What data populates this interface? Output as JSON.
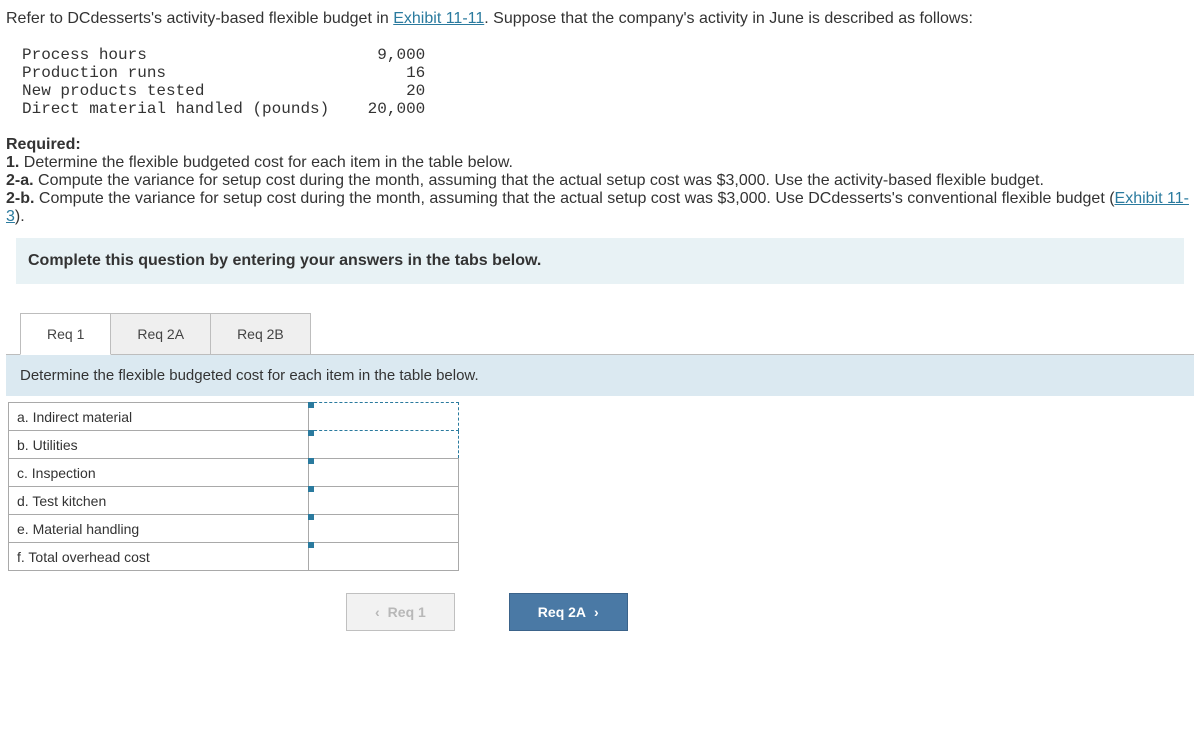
{
  "intro": {
    "prefix": "Refer to DCdesserts's activity-based flexible budget in ",
    "link1": "Exhibit 11-11",
    "suffix": ". Suppose that the company's activity in June is described as follows:"
  },
  "activity": {
    "rows": [
      {
        "label": "Process hours",
        "value": "9,000"
      },
      {
        "label": "Production runs",
        "value": "16"
      },
      {
        "label": "New products tested",
        "value": "20"
      },
      {
        "label": "Direct material handled (pounds)",
        "value": "20,000"
      }
    ]
  },
  "required": {
    "heading": "Required:",
    "item1_bold": "1.",
    "item1_text": " Determine the flexible budgeted cost for each item in the table below.",
    "item2a_bold": "2-a.",
    "item2a_text": " Compute the variance for setup cost during the month, assuming that the actual setup cost was $3,000. Use the activity-based flexible budget.",
    "item2b_bold": "2-b.",
    "item2b_text_pre": " Compute the variance for setup cost during the month, assuming that the actual setup cost was $3,000. Use DCdesserts's conventional flexible budget (",
    "item2b_link": "Exhibit 11-3",
    "item2b_text_post": ")."
  },
  "instruction": "Complete this question by entering your answers in the tabs below.",
  "tabs": {
    "items": [
      "Req 1",
      "Req 2A",
      "Req 2B"
    ],
    "active": 0,
    "panel_text": "Determine the flexible budgeted cost for each item in the table below."
  },
  "answer_rows": [
    "a. Indirect material",
    "b. Utilities",
    "c. Inspection",
    "d. Test kitchen",
    "e. Material handling",
    "f. Total overhead cost"
  ],
  "nav": {
    "prev": "Req 1",
    "next": "Req 2A"
  }
}
